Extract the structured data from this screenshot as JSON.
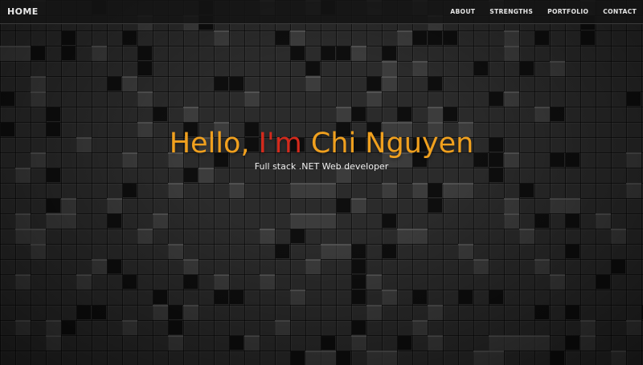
{
  "navbar": {
    "brand": "HOME",
    "links": [
      {
        "label": "ABOUT"
      },
      {
        "label": "STRENGTHS"
      },
      {
        "label": "PORTFOLIO"
      },
      {
        "label": "CONTACT"
      }
    ]
  },
  "hero": {
    "title_pre": "Hello, ",
    "title_accent": "I'm",
    "title_post": " Chi Nguyen",
    "subtitle": "Full stack .NET Web developer"
  },
  "colors": {
    "accent_orange": "#f0a01e",
    "accent_red": "#d42a1c",
    "navbar_bg": "#141414"
  }
}
